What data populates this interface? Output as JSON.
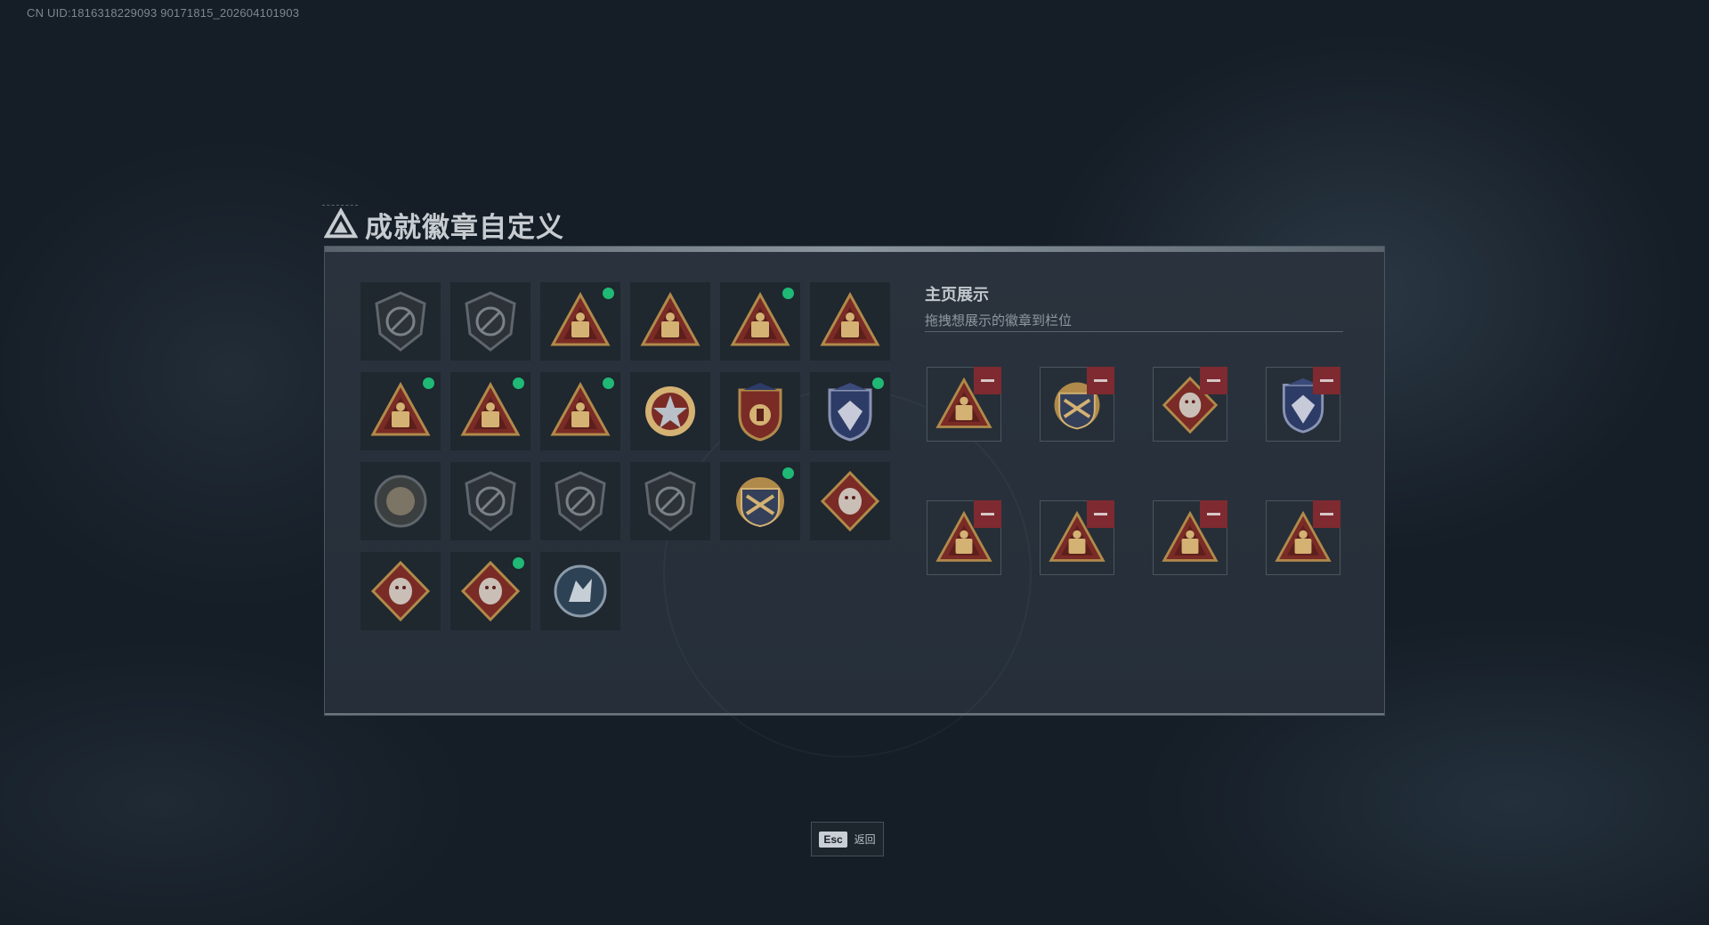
{
  "uid_text": "CN UID:1816318229093 90171815_202604101903",
  "title": "成就徽章自定义",
  "display": {
    "title": "主页展示",
    "subtitle": "拖拽想展示的徽章到栏位"
  },
  "esc": {
    "key": "Esc",
    "label": "返回"
  },
  "colors": {
    "accent_dot": "#1fb875",
    "remove": "#7e2a30"
  },
  "badges": [
    {
      "icon": "triangle-shield-badge-icon",
      "shape": "shield-dark",
      "new": false
    },
    {
      "icon": "helicopter-shield-badge-icon",
      "shape": "shield-dark",
      "new": false
    },
    {
      "icon": "money-bag-triangle-badge-icon",
      "shape": "triangle",
      "new": true
    },
    {
      "icon": "safe-box-triangle-badge-icon",
      "shape": "triangle",
      "new": false
    },
    {
      "icon": "boat-triangle-badge-icon",
      "shape": "triangle",
      "new": true
    },
    {
      "icon": "number-one-triangle-badge-icon",
      "shape": "triangle",
      "new": false
    },
    {
      "icon": "crate-triangle-badge-icon",
      "shape": "triangle",
      "new": true
    },
    {
      "icon": "soldiers-triangle-badge-icon",
      "shape": "triangle",
      "new": true
    },
    {
      "icon": "rockets-triangle-badge-icon",
      "shape": "triangle",
      "new": true
    },
    {
      "icon": "star-compass-badge-icon",
      "shape": "medal",
      "new": false
    },
    {
      "icon": "stars-crest-badge-icon",
      "shape": "crest",
      "new": false
    },
    {
      "icon": "diamond-crest-badge-icon",
      "shape": "crest-blue",
      "new": true
    },
    {
      "icon": "laurel-round-badge-icon",
      "shape": "round",
      "new": false
    },
    {
      "icon": "no-knife-shield-badge-icon",
      "shape": "shield-dark",
      "new": false
    },
    {
      "icon": "no-rifle-shield-badge-icon",
      "shape": "shield-dark",
      "new": false
    },
    {
      "icon": "no-pistol-shield-badge-icon",
      "shape": "shield-dark",
      "new": false
    },
    {
      "icon": "anchor-emblem-badge-icon",
      "shape": "emblem",
      "new": true
    },
    {
      "icon": "wolf-diamond-badge-icon",
      "shape": "diamond",
      "new": false
    },
    {
      "icon": "dragon-diamond-badge-icon",
      "shape": "diamond",
      "new": false
    },
    {
      "icon": "runner-diamond-badge-icon",
      "shape": "diamond",
      "new": true
    },
    {
      "icon": "wolf-round-badge-icon",
      "shape": "round-blue",
      "new": false
    }
  ],
  "slots": [
    {
      "icon": "rockets-triangle-badge-icon",
      "shape": "triangle"
    },
    {
      "icon": "anchor-emblem-badge-icon",
      "shape": "emblem"
    },
    {
      "icon": "runner-diamond-badge-icon",
      "shape": "diamond"
    },
    {
      "icon": "diamond-crest-badge-icon",
      "shape": "crest-blue"
    },
    {
      "icon": "soldiers-triangle-badge-icon",
      "shape": "triangle"
    },
    {
      "icon": "boat-triangle-badge-icon",
      "shape": "triangle"
    },
    {
      "icon": "crate-triangle-badge-icon",
      "shape": "triangle"
    },
    {
      "icon": "money-bag-triangle-badge-icon",
      "shape": "triangle"
    }
  ]
}
